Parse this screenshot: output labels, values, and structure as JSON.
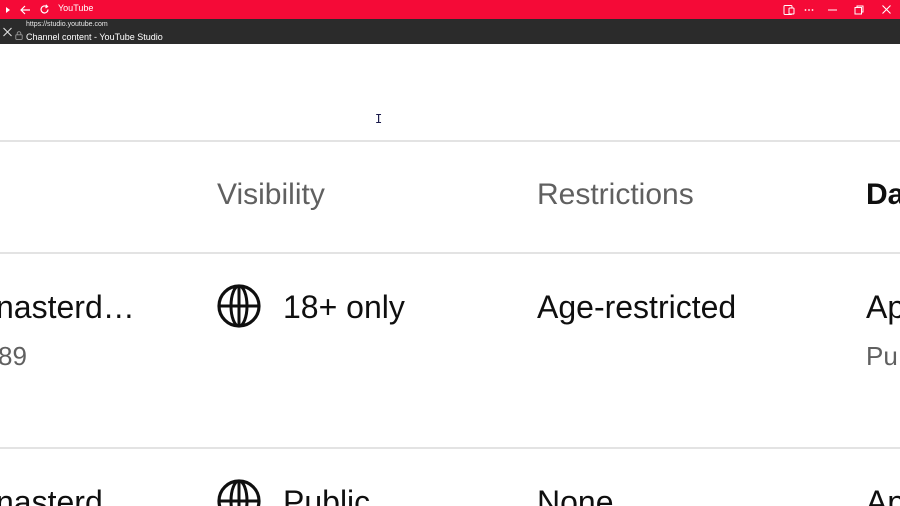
{
  "window": {
    "app_title": "YouTube",
    "accent_color": "#f50a37"
  },
  "urlbar": {
    "url": "https://studio.youtube.com",
    "page_title": "Channel content - YouTube Studio"
  },
  "table": {
    "headers": {
      "visibility": "Visibility",
      "restrictions": "Restrictions",
      "date": "Dat"
    },
    "rows": [
      {
        "video_title": "nasterd…",
        "video_sub": "89",
        "visibility_icon": "globe-icon",
        "visibility": "18+ only",
        "restrictions": "Age-restricted",
        "date": "Ap",
        "date_sub": "Pu"
      },
      {
        "video_title": "nasterd…",
        "visibility_icon": "globe-icon",
        "visibility": "Public",
        "restrictions": "None",
        "date": "Ap"
      }
    ]
  }
}
